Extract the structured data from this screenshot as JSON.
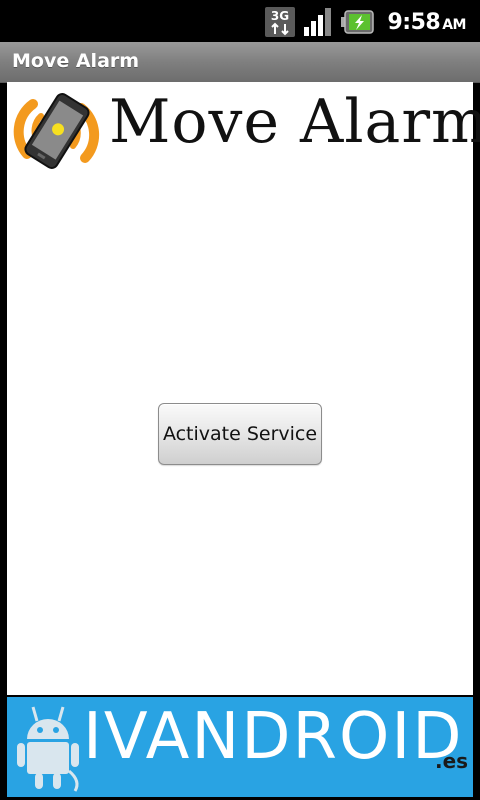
{
  "status_bar": {
    "network_label": "3G",
    "time": "9:58",
    "ampm": "AM",
    "icons": [
      "3g-data-icon",
      "signal-strength-icon",
      "battery-charging-icon"
    ]
  },
  "app": {
    "title": "Move Alarm"
  },
  "logo": {
    "wordmark": "Move Alarm",
    "icon": "phone-vibrate-icon",
    "accent_color": "#f39a1e"
  },
  "main": {
    "activate_button_label": "Activate Service"
  },
  "banner": {
    "wordmark": "IVANDROID",
    "tld": ".es",
    "background_color": "#29a3e3",
    "icon": "android-robot-icon"
  }
}
